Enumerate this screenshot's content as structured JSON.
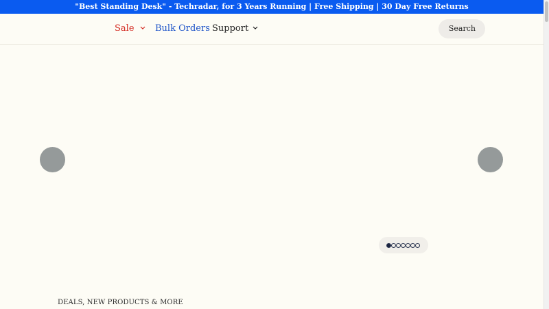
{
  "announcement": {
    "text": "\"Best Standing Desk\" - Techradar, for 3 Years Running | Free Shipping | 30 Day Free Returns"
  },
  "nav": {
    "sale_label": "Sale",
    "bulk_orders_label": "Bulk Orders",
    "support_label": "Support"
  },
  "search": {
    "label": "Search"
  },
  "carousel": {
    "slide_count": 7,
    "active_slide": 1
  },
  "section": {
    "heading": "DEALS, NEW PRODUCTS & MORE"
  },
  "colors": {
    "announcement_bg": "#0a5bf0",
    "sale_red": "#d42b22",
    "link_blue": "#1e54c8",
    "page_bg": "#fdfcf5"
  },
  "icons": {
    "sale_chevron": "chevron-down-icon",
    "support_chevron": "chevron-down-icon"
  }
}
